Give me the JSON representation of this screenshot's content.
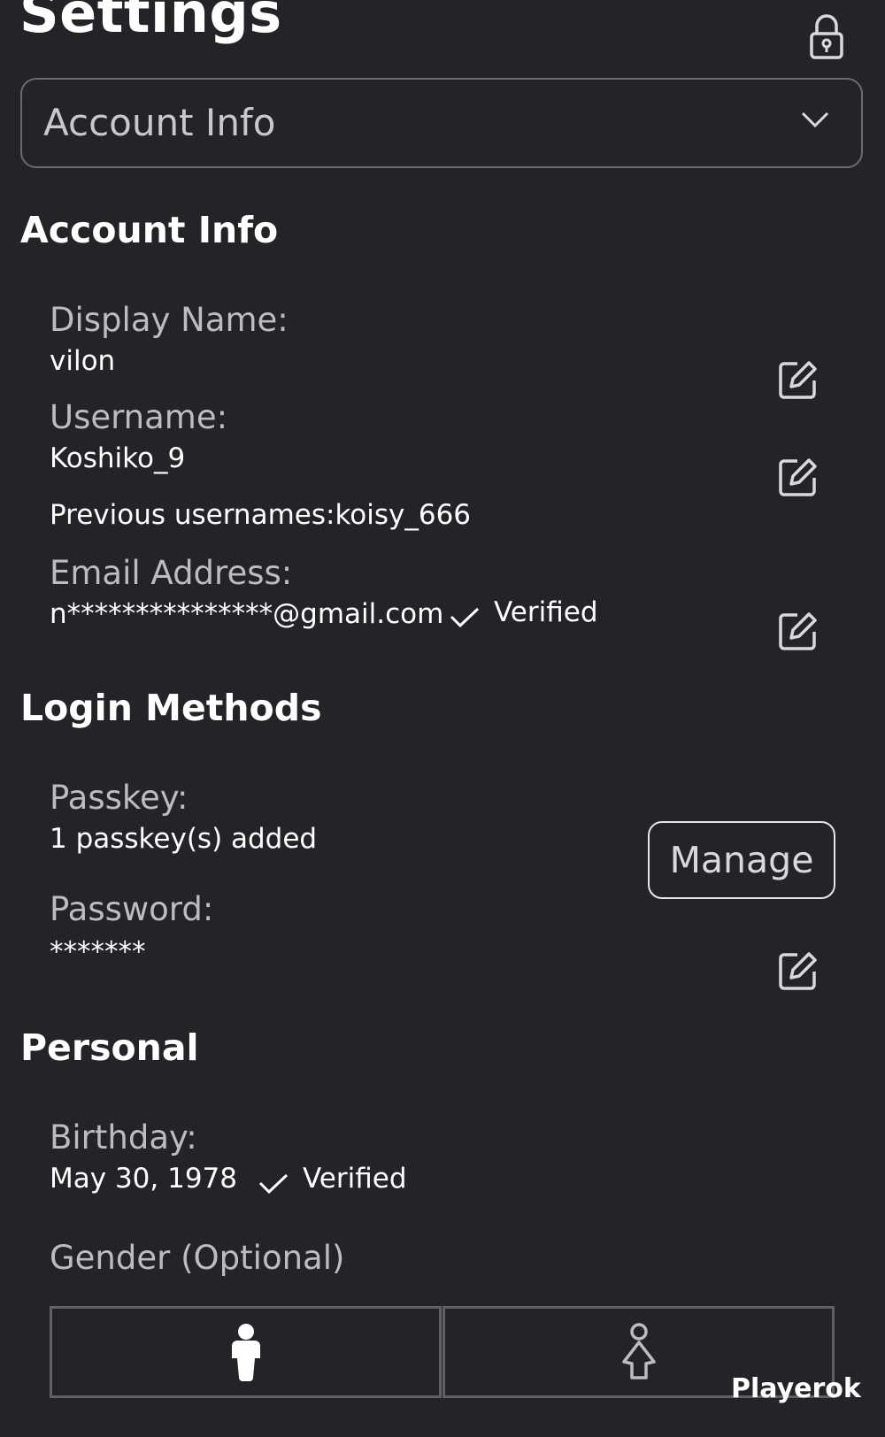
{
  "header": {
    "title": "Settings",
    "lock_icon": "lock-icon"
  },
  "section_selector": {
    "selected": "Account Info",
    "icon": "chevron-down-icon"
  },
  "account_info": {
    "title": "Account Info",
    "display_name_label": "Display Name:",
    "display_name_value": "vilon",
    "username_label": "Username:",
    "username_value": "Koshiko_9",
    "previous_usernames": "Previous usernames:koisy_666",
    "email_label": "Email Address:",
    "email_value": "n***************@gmail.com",
    "email_status": "Verified"
  },
  "login_methods": {
    "title": "Login Methods",
    "passkey_label": "Passkey:",
    "passkey_value": "1 passkey(s) added",
    "manage_label": "Manage",
    "password_label": "Password:",
    "password_value": "*******"
  },
  "personal": {
    "title": "Personal",
    "birthday_label": "Birthday:",
    "birthday_value": "May 30, 1978",
    "birthday_status": "Verified",
    "gender_label": "Gender (Optional)",
    "gender_options": [
      "male-icon",
      "female-icon"
    ]
  },
  "watermark": "Playerok",
  "colors": {
    "background": "#232427",
    "text": "#ffffff",
    "muted_text": "#bcbdc0",
    "border": "#6b6c70"
  }
}
